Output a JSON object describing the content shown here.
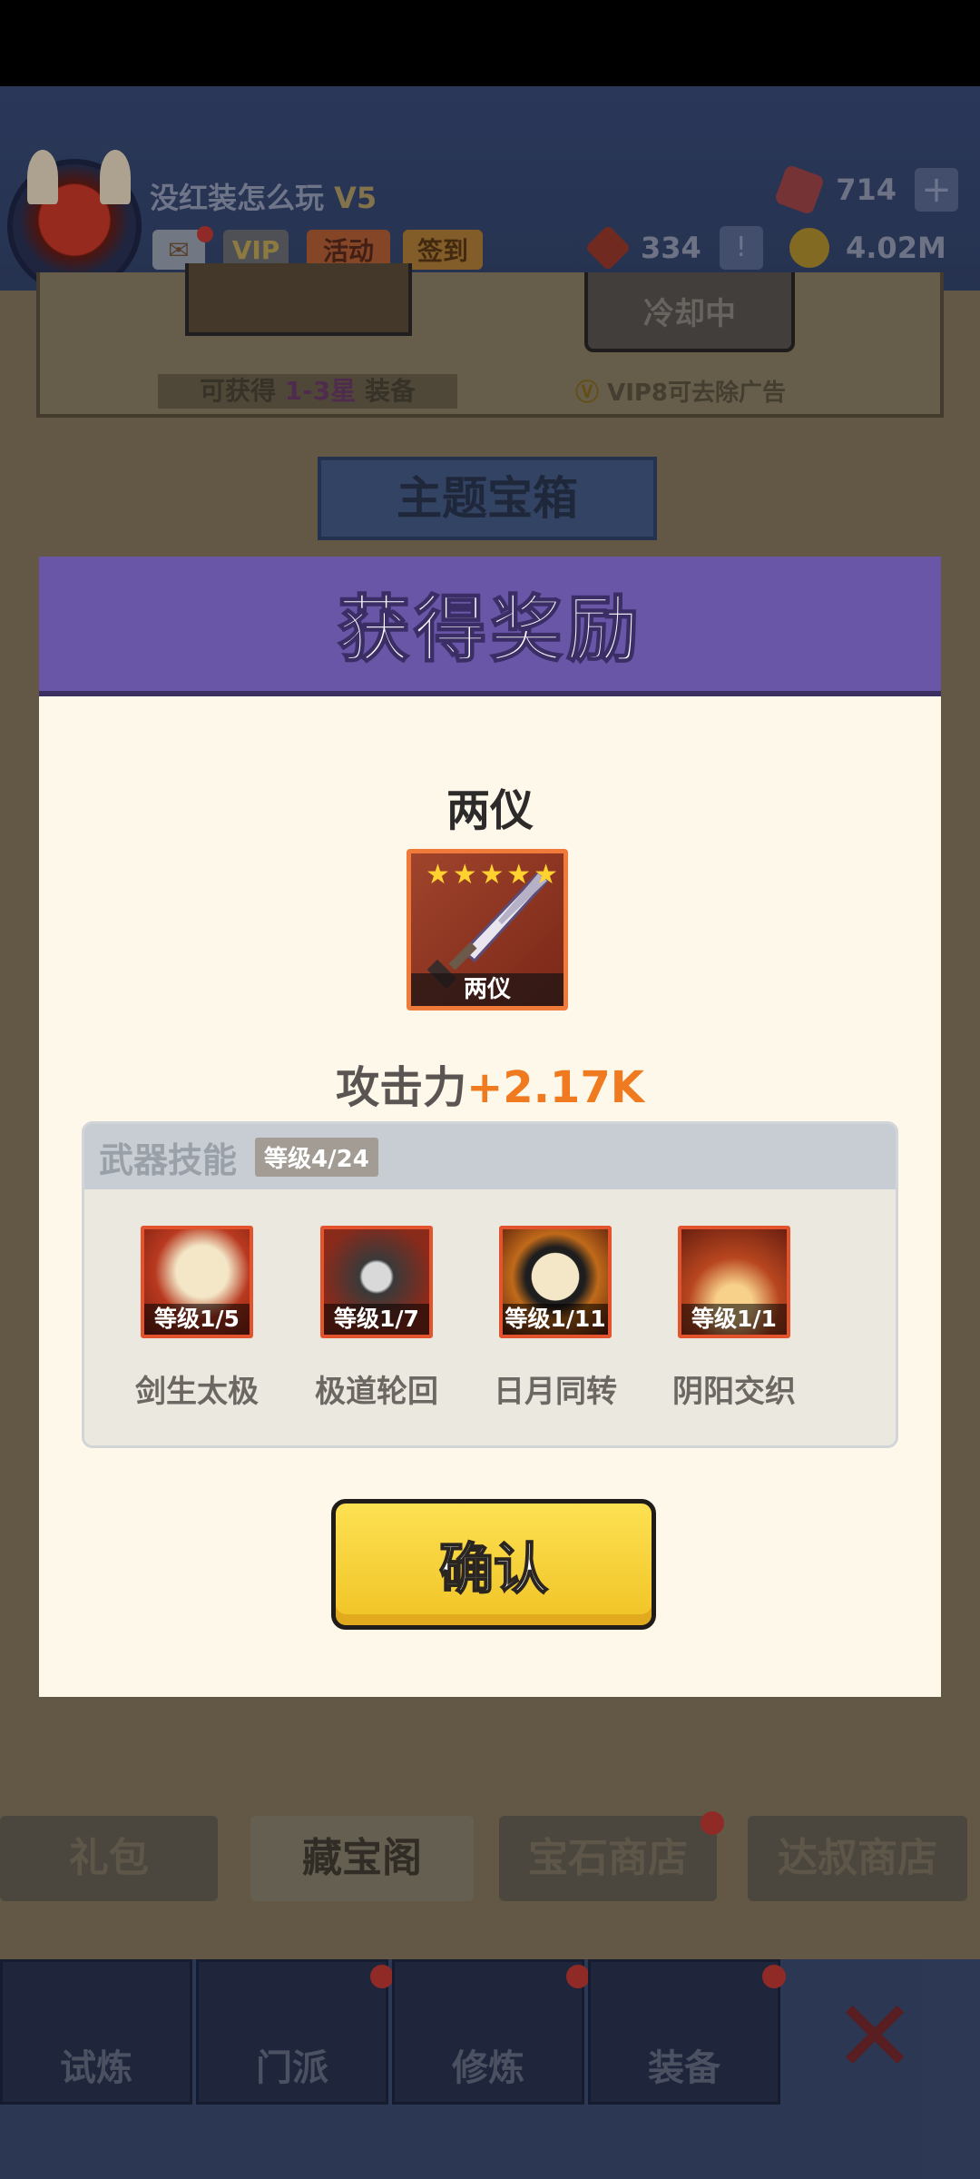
{
  "header": {
    "player_name": "没红装怎么玩",
    "vip_level": "V5",
    "badges": {
      "vip": "VIP",
      "event": "活动",
      "signin": "签到"
    },
    "resources": {
      "gems": "714",
      "tokens": "334",
      "gold": "4.02M"
    }
  },
  "chest": {
    "cooldown_label": "冷却中",
    "hint_prefix": "可获得",
    "hint_range": "1-3星",
    "hint_suffix": "装备",
    "vip_hint": "VIP8可去除广告"
  },
  "theme_chest_title": "主题宝箱",
  "shop_tabs": [
    "礼包",
    "藏宝阁",
    "宝石商店",
    "达叔商店"
  ],
  "nav_items": [
    "试炼",
    "门派",
    "修炼",
    "装备"
  ],
  "modal": {
    "title": "获得奖励",
    "item_name": "两仪",
    "item_caption": "两仪",
    "stars": 5,
    "attack_label": "攻击力",
    "attack_value": "+2.17K",
    "skills_title": "武器技能",
    "skills_level": "等级4/24",
    "skills": [
      {
        "name": "剑生太极",
        "level": "等级1/5"
      },
      {
        "name": "极道轮回",
        "level": "等级1/7"
      },
      {
        "name": "日月同转",
        "level": "等级1/11"
      },
      {
        "name": "阴阳交织",
        "level": "等级1/1"
      }
    ],
    "confirm_label": "确认"
  },
  "colors": {
    "modal_header": "#6a56a6",
    "attack_value": "#ef7a1f",
    "confirm_button": "#f8d43a"
  }
}
